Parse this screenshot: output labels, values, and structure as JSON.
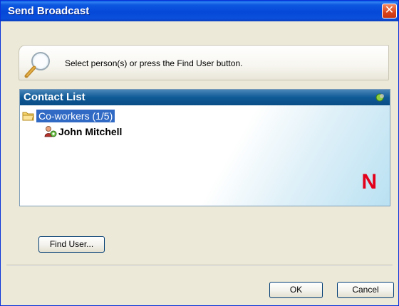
{
  "window": {
    "title": "Send Broadcast",
    "close_glyph": "✕"
  },
  "hint": {
    "text": "Select person(s) or press the Find User button.",
    "icon": "magnifier-icon"
  },
  "contact_list": {
    "header": "Contact List",
    "group": {
      "label": "Co-workers  (1/5)",
      "icon": "folder-icon",
      "selected": true
    },
    "users": [
      {
        "name": "John Mitchell",
        "icon": "user-online-icon"
      }
    ],
    "logo_text": "N"
  },
  "buttons": {
    "find_user": "Find User...",
    "ok": "OK",
    "cancel": "Cancel"
  },
  "colors": {
    "titlebar": "#0548d8",
    "header": "#0f5a97",
    "selection": "#316ac5",
    "logo": "#e3001b"
  }
}
